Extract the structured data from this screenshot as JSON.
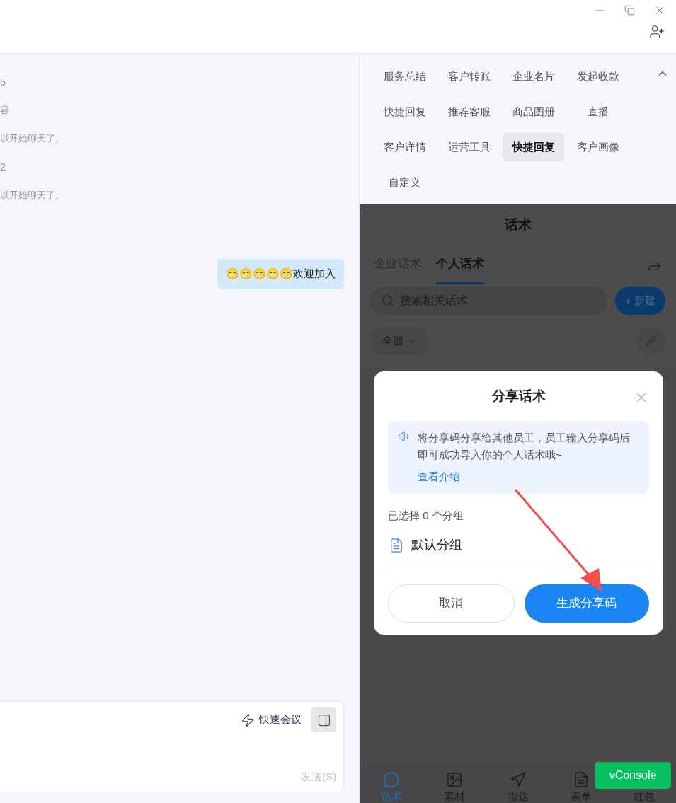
{
  "chat": {
    "lines": [
      {
        "kind": "name",
        "text": "5"
      },
      {
        "kind": "note",
        "text": "容"
      },
      {
        "kind": "note",
        "text": "以开始聊天了。"
      },
      {
        "kind": "name",
        "text": "2"
      },
      {
        "kind": "note",
        "text": "以开始聊天了。"
      }
    ],
    "bubble": "😁😁😁😁😁欢迎加入",
    "composer": {
      "quick_meeting": "快速会议",
      "send": "发送(S)"
    }
  },
  "tools": {
    "expanded": true,
    "items": [
      {
        "label": "服务总结",
        "selected": false
      },
      {
        "label": "客户转账",
        "selected": false
      },
      {
        "label": "企业名片",
        "selected": false
      },
      {
        "label": "发起收款",
        "selected": false
      },
      {
        "label": "快捷回复",
        "selected": false
      },
      {
        "label": "推荐客服",
        "selected": false
      },
      {
        "label": "商品图册",
        "selected": false
      },
      {
        "label": "直播",
        "selected": false
      },
      {
        "label": "客户详情",
        "selected": false
      },
      {
        "label": "运营工具",
        "selected": false
      },
      {
        "label": "快捷回复",
        "selected": true
      },
      {
        "label": "客户画像",
        "selected": false
      },
      {
        "label": "自定义",
        "selected": false
      }
    ]
  },
  "panel": {
    "title": "话术",
    "tabs": [
      {
        "label": "企业话术",
        "selected": false
      },
      {
        "label": "个人话术",
        "selected": true
      }
    ],
    "search": {
      "placeholder": "搜索相关话术"
    },
    "new_button": "+ 新建",
    "filter": "全部"
  },
  "dialog": {
    "title": "分享话术",
    "notice": "将分享码分享给其他员工，员工输入分享码后即可成功导入你的个人话术哦~",
    "link": "查看介绍",
    "selected_count": "已选择 0 个分组",
    "groups": [
      {
        "label": "默认分组"
      }
    ],
    "cancel": "取消",
    "confirm": "生成分享码"
  },
  "bottom_nav": [
    {
      "label": "话术",
      "selected": true
    },
    {
      "label": "素材",
      "selected": false
    },
    {
      "label": "雷达",
      "selected": false
    },
    {
      "label": "表单",
      "selected": false
    },
    {
      "label": "红包",
      "selected": false
    }
  ],
  "vconsole": "vConsole"
}
